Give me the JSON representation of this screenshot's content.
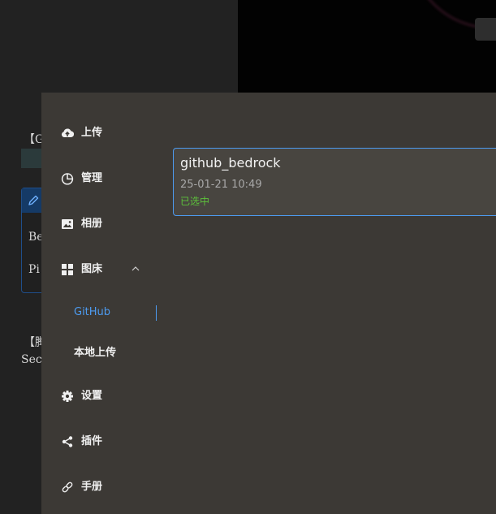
{
  "background": {
    "fragments": [
      "【G",
      "Be",
      "Pi",
      "【腾",
      "Secr"
    ]
  },
  "sidebar": {
    "items": [
      {
        "label": "上传",
        "icon": "cloud-upload-icon"
      },
      {
        "label": "管理",
        "icon": "pie-chart-icon"
      },
      {
        "label": "相册",
        "icon": "picture-icon"
      },
      {
        "label": "图床",
        "icon": "grid-icon"
      },
      {
        "label": "设置",
        "icon": "gear-icon"
      },
      {
        "label": "插件",
        "icon": "share-icon"
      },
      {
        "label": "手册",
        "icon": "link-icon"
      }
    ],
    "submenu": [
      {
        "label": "GitHub",
        "active": true
      },
      {
        "label": "本地上传",
        "active": false
      }
    ]
  },
  "config_card": {
    "name": "github_bedrock",
    "time": "25-01-21 10:49",
    "status": "已选中"
  },
  "colors": {
    "accent": "#4d9bf0",
    "selected_green": "#5dc23b",
    "panel": "#3c3935",
    "card": "#484540"
  }
}
